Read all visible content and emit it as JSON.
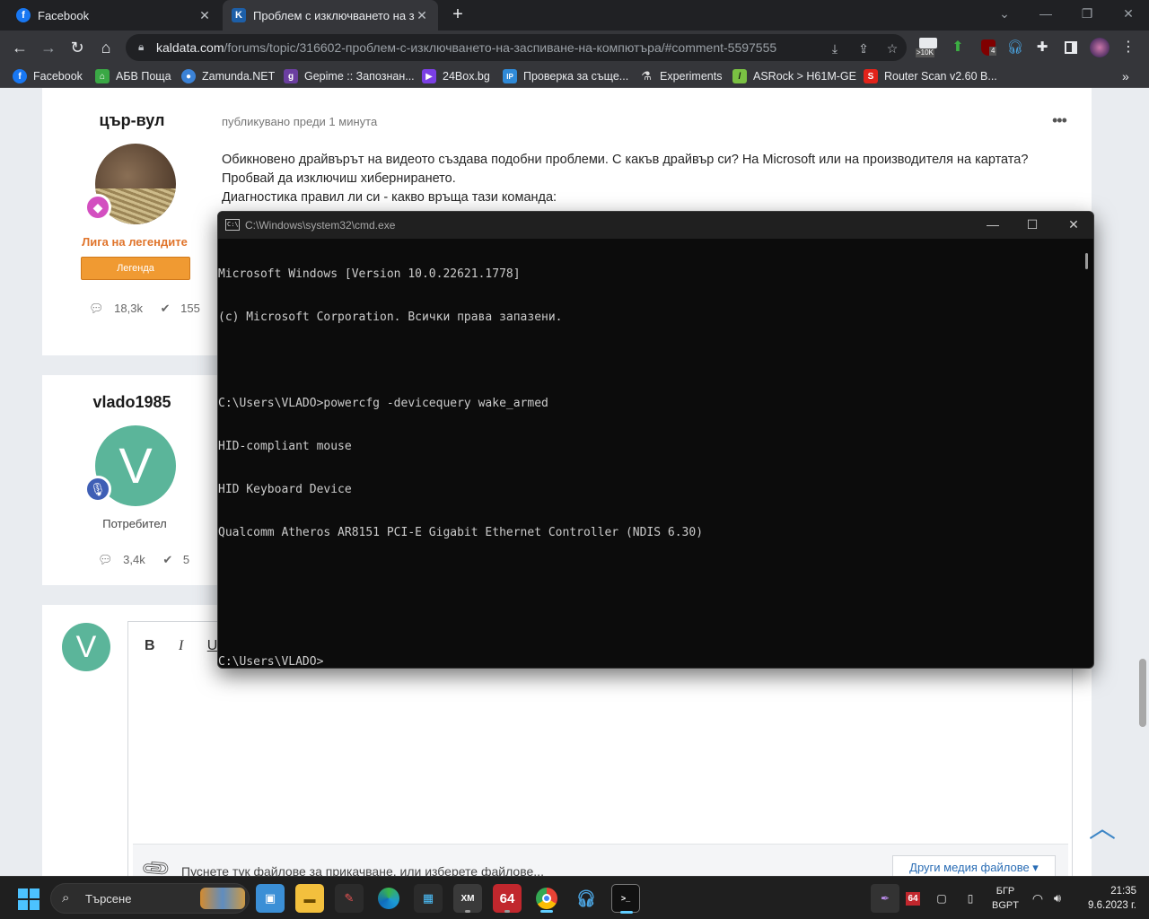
{
  "browser": {
    "tabs": [
      {
        "title": "Facebook",
        "active": false
      },
      {
        "title": "Проблем с изключването на засп",
        "active": true
      }
    ],
    "url_host": "kaldata.com",
    "url_path": "/forums/topic/316602-проблем-с-изключването-на-заспиване-на-компютъра/#comment-5597555",
    "extensions": {
      "badge_10k": ">10K",
      "badge_4": "4"
    },
    "bookmarks": [
      {
        "label": "Facebook",
        "icon": "facebook-icon",
        "color": "#1877f2"
      },
      {
        "label": "АБВ Поща",
        "icon": "home-icon",
        "color": "#3aa845"
      },
      {
        "label": "Zamunda.NET",
        "icon": "globe-icon",
        "color": "#3b82d6"
      },
      {
        "label": "Gepime :: Запознан...",
        "icon": "g-icon",
        "color": "#6b3fa0"
      },
      {
        "label": "24Box.bg",
        "icon": "play-icon",
        "color": "#7b3fe4"
      },
      {
        "label": "Проверка за съще...",
        "icon": "ip-icon",
        "color": "#2f8ad8"
      },
      {
        "label": "Experiments",
        "icon": "flask-icon",
        "color": "#dddddd"
      },
      {
        "label": "ASRock > H61M-GE",
        "icon": "asrock-icon",
        "color": "#7ac143"
      },
      {
        "label": "Router Scan v2.60 B...",
        "icon": "s-icon",
        "color": "#e2231a"
      }
    ]
  },
  "post1": {
    "author": "цър-вул",
    "rank": "Лига на легендите",
    "rank_button": "Легенда",
    "stats": {
      "posts": "18,3k",
      "reputation": "155"
    },
    "meta": "публикувано преди 1 минута",
    "body": [
      "Обикновено драйвърът на видеото създава подобни проблеми. С какъв драйвър си? На Microsoft или на производителя на картата?",
      "Пробвай да изключиш хибернирането.",
      "Диагностика правил ли си - какво връща тази команда:"
    ]
  },
  "post2": {
    "author": "vlado1985",
    "avatar_letter": "V",
    "rank": "Потребител",
    "stats": {
      "posts": "3,4k",
      "reputation": "5"
    }
  },
  "reply": {
    "avatar_letter": "V",
    "toolbar": {
      "bold": "B",
      "italic": "I",
      "underline": "U"
    },
    "attach_text": "Пуснете тук файлове за прикачване, или изберете файлове...",
    "media_button": "Други медия файлове ▾"
  },
  "cmd": {
    "title": "C:\\Windows\\system32\\cmd.exe",
    "lines": [
      "Microsoft Windows [Version 10.0.22621.1778]",
      "(c) Microsoft Corporation. Всички права запазени.",
      "",
      "C:\\Users\\VLADO>powercfg -devicequery wake_armed",
      "HID-compliant mouse",
      "HID Keyboard Device",
      "Qualcomm Atheros AR8151 PCI-E Gigabit Ethernet Controller (NDIS 6.30)",
      "",
      "",
      "C:\\Users\\VLADO>"
    ]
  },
  "taskbar": {
    "search_placeholder": "Търсене",
    "apps": [
      "file-explorer-pc",
      "folder",
      "paint-app",
      "edge",
      "store",
      "xmplay",
      "aida64",
      "chrome",
      "headset",
      "terminal"
    ],
    "aida_label": "64",
    "xm_label": "XM",
    "tray_aida": "64",
    "lang": "БГР",
    "layout": "BGPT",
    "time": "21:35",
    "date": "9.6.2023 г."
  }
}
